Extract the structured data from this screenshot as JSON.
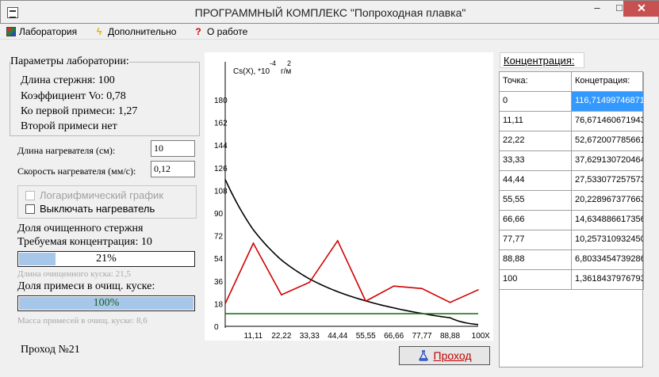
{
  "window": {
    "title": "ПРОГРАММНЫЙ КОМПЛЕКС \"Попроходная плавка\"",
    "minimize": "–",
    "maximize": "□",
    "close": "✕"
  },
  "menu": [
    {
      "label": "Лаборатория",
      "icon": "lab-icon"
    },
    {
      "label": "Дополнительно",
      "icon": "lightning-icon"
    },
    {
      "label": "О работе",
      "icon": "question-icon"
    }
  ],
  "params": {
    "title": "Параметры лаборатории:",
    "lines": [
      "Длина стержня: 100",
      "Коэффициент Vo: 0,78",
      "Ко первой примеси: 1,27",
      "Второй примеси нет"
    ]
  },
  "heater": {
    "length_label": "Длина нагревателя (см):",
    "length_value": "10",
    "speed_label": "Скорость нагревателя (мм/с):",
    "speed_value": "0,12"
  },
  "options": {
    "log_label": "Логарифмический график",
    "log_checked": false,
    "log_enabled": false,
    "heater_off_label": "Выключать нагреватель",
    "heater_off_checked": false
  },
  "cleaned": {
    "title": "Доля очищенного стержня",
    "required": "Требуемая концентрация: 10",
    "progress_fraction": 0.21,
    "progress_text": "21%",
    "hint": "Длина очищенного куска: 21,5"
  },
  "impurity": {
    "title": "Доля примеси в очищ. куске:",
    "progress_fraction": 1.0,
    "progress_text": "100%",
    "hint": "Масса примесей в очищ. куске: 8,6"
  },
  "pass_label": "Проход №21",
  "pass_button": "Проход",
  "concentration": {
    "title": "Концентрация:",
    "headers": [
      "Точка:",
      "Концетрация:"
    ],
    "rows": [
      [
        "0",
        "116,71499746871"
      ],
      [
        "11,11",
        "76,671460671943"
      ],
      [
        "22,22",
        "52,672007785661"
      ],
      [
        "33,33",
        "37,629130720464"
      ],
      [
        "44,44",
        "27,533077257573"
      ],
      [
        "55,55",
        "20,228967377663"
      ],
      [
        "66,66",
        "14,634886617356"
      ],
      [
        "77,77",
        "10,257310932450"
      ],
      [
        "88,88",
        "6,8033454739286"
      ],
      [
        "100",
        "1,3618437976793"
      ]
    ],
    "selected_row": 0
  },
  "chart_data": {
    "type": "line",
    "ylabel_main": "Cs(X), *10",
    "ylabel_exp": "-4",
    "ylabel_unit": "г/м",
    "ylabel_unit_exp": "2",
    "xlabel": "X",
    "ylim": [
      0,
      180
    ],
    "xlim": [
      0,
      100
    ],
    "yticks": [
      "0",
      "18",
      "36",
      "54",
      "72",
      "90",
      "108",
      "126",
      "144",
      "162",
      "180"
    ],
    "xticks": [
      "11,11",
      "22,22",
      "33,33",
      "44,44",
      "55,55",
      "66,66",
      "77,77",
      "88,88",
      "100"
    ],
    "series": [
      {
        "color": "#000000",
        "x": [
          0,
          11.11,
          22.22,
          33.33,
          44.44,
          55.55,
          66.66,
          77.77,
          88.88,
          100
        ],
        "values": [
          116.7,
          76.67,
          52.67,
          37.63,
          27.53,
          20.23,
          14.63,
          10.26,
          6.8,
          1.36
        ]
      },
      {
        "color": "#d00000",
        "x": [
          0,
          11.11,
          22.22,
          33.33,
          44.44,
          55.55,
          66.66,
          77.77,
          88.88,
          100
        ],
        "values": [
          18,
          66,
          25,
          35,
          68,
          20,
          32,
          30,
          19,
          29
        ]
      },
      {
        "color": "#1a7a1a",
        "x": [
          0,
          100
        ],
        "values": [
          10,
          10
        ]
      }
    ]
  }
}
